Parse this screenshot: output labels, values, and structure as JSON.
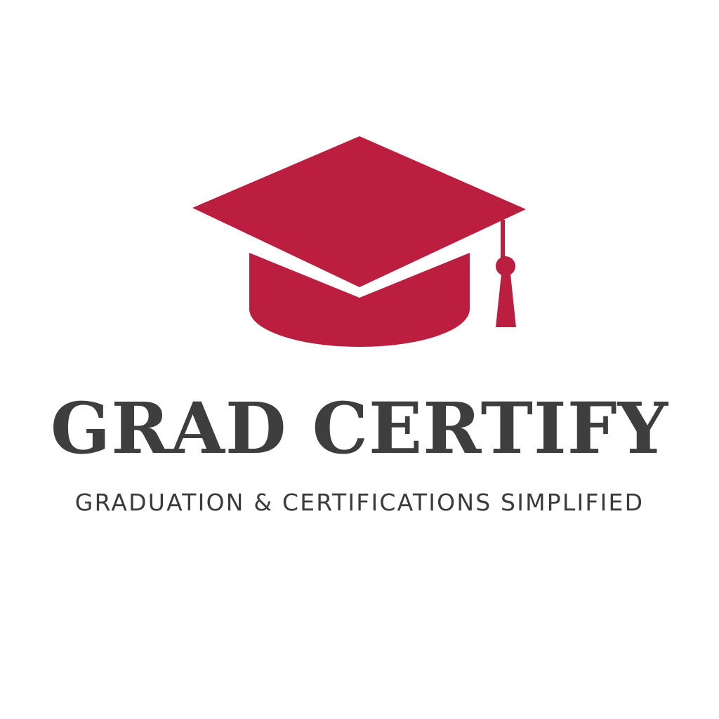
{
  "brand": {
    "name": "GRAD CERTIFY",
    "tagline": "GRADUATION & CERTIFICATIONS SIMPLIFIED"
  },
  "logo": {
    "icon": "graduation-cap-icon",
    "accent_color": "#bc1e3f",
    "text_color": "#3e3e3e",
    "background_color": "#ffffff"
  }
}
